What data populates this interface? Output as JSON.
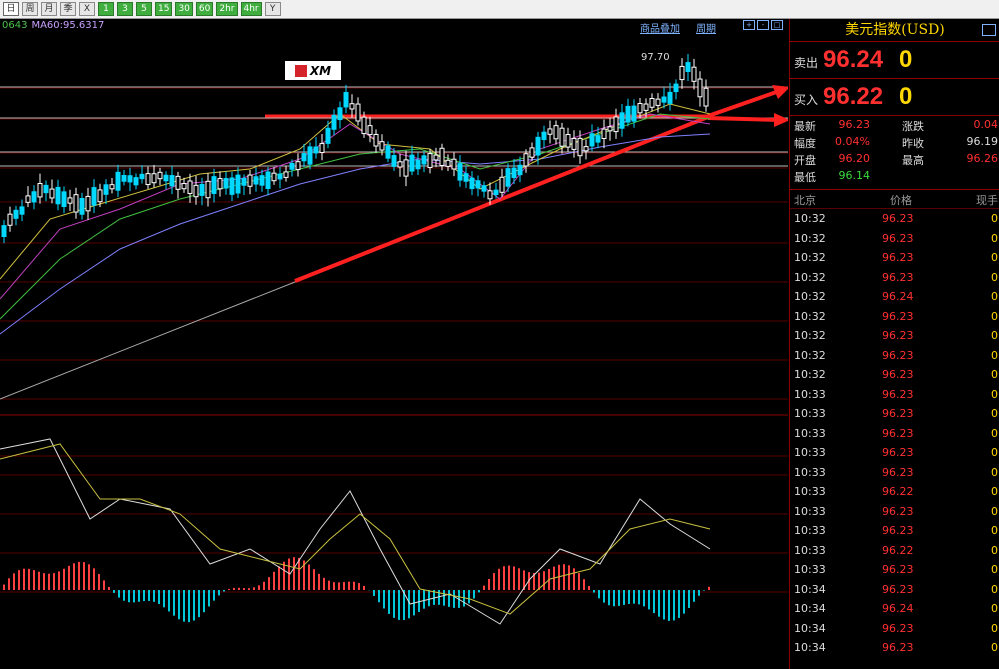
{
  "toolbar": {
    "buttons": [
      "日",
      "周",
      "月",
      "季",
      "X",
      "1",
      "3",
      "5",
      "15",
      "30",
      "60",
      "2hr",
      "4hr",
      "Y"
    ]
  },
  "chart": {
    "ma_legend_left": "0643",
    "ma60_label": "MA60:95.6317",
    "link_overlay": "商品叠加",
    "link_period": "周期",
    "peak_label": "97.70",
    "logo_text": "XM",
    "colors": {
      "up": "#00d8ff",
      "down": "#ffffff",
      "arrow": "#ff2020",
      "macd_up": "#ff4040",
      "macd_down": "#00c8d8"
    }
  },
  "panel": {
    "title": "美元指数(USD)",
    "sell_label": "卖出",
    "sell_price": "96.24",
    "sell_vol": "0",
    "buy_label": "买入",
    "buy_price": "96.22",
    "buy_vol": "0",
    "stats": [
      {
        "l1": "最新",
        "v1": "96.23",
        "l2": "涨跌",
        "v2": "0.04"
      },
      {
        "l1": "幅度",
        "v1": "0.04%",
        "l2": "昨收",
        "v2": "96.19"
      },
      {
        "l1": "开盘",
        "v1": "96.20",
        "l2": "最高",
        "v2": "96.26"
      },
      {
        "l1": "最低",
        "v1": "96.14",
        "l2": "",
        "v2": ""
      }
    ],
    "ticks_header": {
      "time": "北京",
      "price": "价格",
      "qty": "现手"
    },
    "ticks": [
      {
        "time": "10:32",
        "price": "96.23",
        "qty": "0"
      },
      {
        "time": "10:32",
        "price": "96.23",
        "qty": "0"
      },
      {
        "time": "10:32",
        "price": "96.23",
        "qty": "0"
      },
      {
        "time": "10:32",
        "price": "96.23",
        "qty": "0"
      },
      {
        "time": "10:32",
        "price": "96.24",
        "qty": "0"
      },
      {
        "time": "10:32",
        "price": "96.23",
        "qty": "0"
      },
      {
        "time": "10:32",
        "price": "96.23",
        "qty": "0"
      },
      {
        "time": "10:32",
        "price": "96.23",
        "qty": "0"
      },
      {
        "time": "10:32",
        "price": "96.23",
        "qty": "0"
      },
      {
        "time": "10:33",
        "price": "96.23",
        "qty": "0"
      },
      {
        "time": "10:33",
        "price": "96.23",
        "qty": "0"
      },
      {
        "time": "10:33",
        "price": "96.23",
        "qty": "0"
      },
      {
        "time": "10:33",
        "price": "96.23",
        "qty": "0"
      },
      {
        "time": "10:33",
        "price": "96.23",
        "qty": "0"
      },
      {
        "time": "10:33",
        "price": "96.22",
        "qty": "0"
      },
      {
        "time": "10:33",
        "price": "96.23",
        "qty": "0"
      },
      {
        "time": "10:33",
        "price": "96.23",
        "qty": "0"
      },
      {
        "time": "10:33",
        "price": "96.22",
        "qty": "0"
      },
      {
        "time": "10:33",
        "price": "96.23",
        "qty": "0"
      },
      {
        "time": "10:34",
        "price": "96.23",
        "qty": "0"
      },
      {
        "time": "10:34",
        "price": "96.24",
        "qty": "0"
      },
      {
        "time": "10:34",
        "price": "96.23",
        "qty": "0"
      },
      {
        "time": "10:34",
        "price": "96.23",
        "qty": "0"
      }
    ]
  }
}
